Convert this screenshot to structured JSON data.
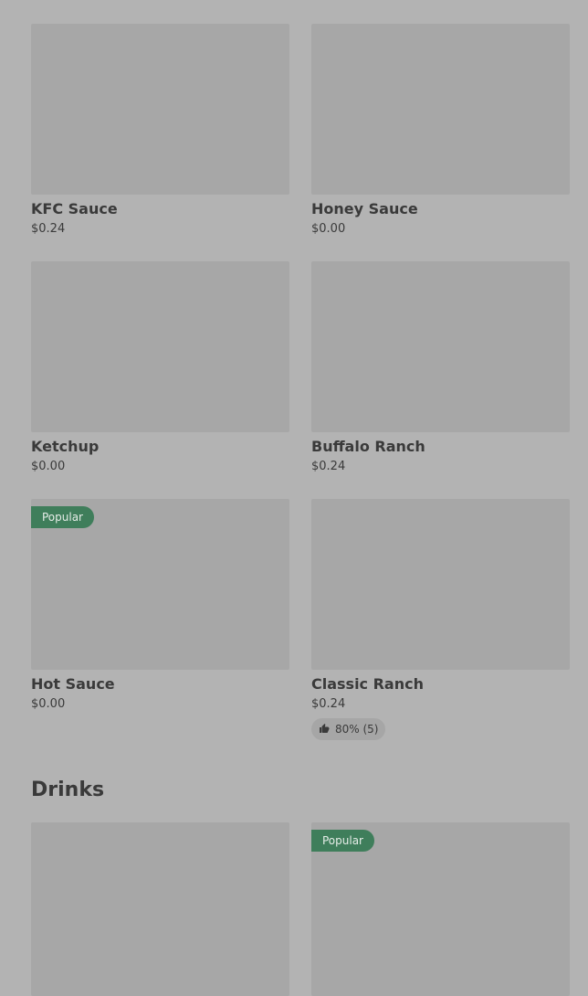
{
  "sauces": {
    "items": [
      {
        "name": "KFC Sauce",
        "price": "$0.24"
      },
      {
        "name": "Honey Sauce",
        "price": "$0.00"
      },
      {
        "name": "Ketchup",
        "price": "$0.00"
      },
      {
        "name": "Buffalo Ranch",
        "price": "$0.24"
      },
      {
        "name": "Hot Sauce",
        "price": "$0.00",
        "badge": "Popular"
      },
      {
        "name": "Classic Ranch",
        "price": "$0.24",
        "rating": "80% (5)"
      }
    ]
  },
  "drinks": {
    "title": "Drinks",
    "items": [
      {
        "name": "",
        "price": ""
      },
      {
        "name": "",
        "price": "",
        "badge": "Popular"
      }
    ]
  },
  "colors": {
    "background": "#b3b3b3",
    "image_placeholder": "#a7a7a7",
    "badge": "#3f7e5b"
  },
  "icons": {
    "rating": "thumbs-up-icon"
  }
}
